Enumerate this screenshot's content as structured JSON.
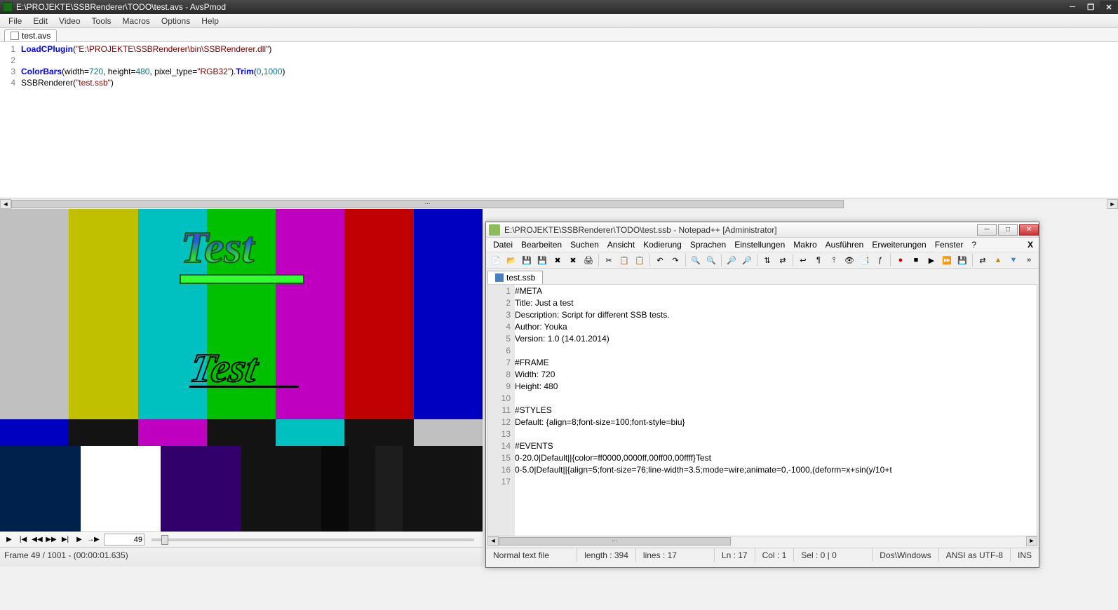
{
  "avspmod": {
    "title": "E:\\PROJEKTE\\SSBRenderer\\TODO\\test.avs - AvsPmod",
    "menu": [
      "File",
      "Edit",
      "Video",
      "Tools",
      "Macros",
      "Options",
      "Help"
    ],
    "tab": "test.avs",
    "lines": [
      "1",
      "2",
      "3",
      "4"
    ],
    "code": {
      "l1a": "LoadCPlugin",
      "l1b": "(",
      "l1c": "\"E:\\PROJEKTE\\SSBRenderer\\bin\\SSBRenderer.dll\"",
      "l1d": ")",
      "l3a": "ColorBars",
      "l3b": "(width=",
      "l3c": "720",
      "l3d": ", height=",
      "l3e": "480",
      "l3f": ", pixel_type=",
      "l3g": "\"RGB32\"",
      "l3h": ").",
      "l3i": "Trim",
      "l3j": "(",
      "l3k": "0",
      "l3l": ",",
      "l3m": "1000",
      "l3n": ")",
      "l4a": "SSBRenderer(",
      "l4b": "\"test.ssb\"",
      "l4c": ")"
    },
    "frame_input": "49",
    "status": "Frame 49 / 1001  -  (00:00:01.635)",
    "overlay1": "Test",
    "overlay2": "Test"
  },
  "npp": {
    "title": "E:\\PROJEKTE\\SSBRenderer\\TODO\\test.ssb - Notepad++ [Administrator]",
    "menu": [
      "Datei",
      "Bearbeiten",
      "Suchen",
      "Ansicht",
      "Kodierung",
      "Sprachen",
      "Einstellungen",
      "Makro",
      "Ausführen",
      "Erweiterungen",
      "Fenster",
      "?"
    ],
    "tab": "test.ssb",
    "lines": [
      "1",
      "2",
      "3",
      "4",
      "5",
      "6",
      "7",
      "8",
      "9",
      "10",
      "11",
      "12",
      "13",
      "14",
      "15",
      "16",
      "17"
    ],
    "code": [
      "#META",
      "Title: Just a test",
      "Description: Script for different SSB tests.",
      "Author: Youka",
      "Version: 1.0 (14.01.2014)",
      "",
      "#FRAME",
      "Width: 720",
      "Height: 480",
      "",
      "#STYLES",
      "Default: {align=8;font-size=100;font-style=biu}",
      "",
      "#EVENTS",
      "0-20.0|Default||{color=ff0000,0000ff,00ff00,00ffff}Test",
      "0-5.0|Default||{align=5;font-size=76;line-width=3.5;mode=wire;animate=0,-1000,(deform=x+sin(y/10+t",
      ""
    ],
    "status": {
      "type": "Normal text file",
      "length": "length : 394",
      "lines": "lines : 17",
      "ln": "Ln : 17",
      "col": "Col : 1",
      "sel": "Sel : 0 | 0",
      "eol": "Dos\\Windows",
      "enc": "ANSI as UTF-8",
      "ins": "INS"
    }
  }
}
